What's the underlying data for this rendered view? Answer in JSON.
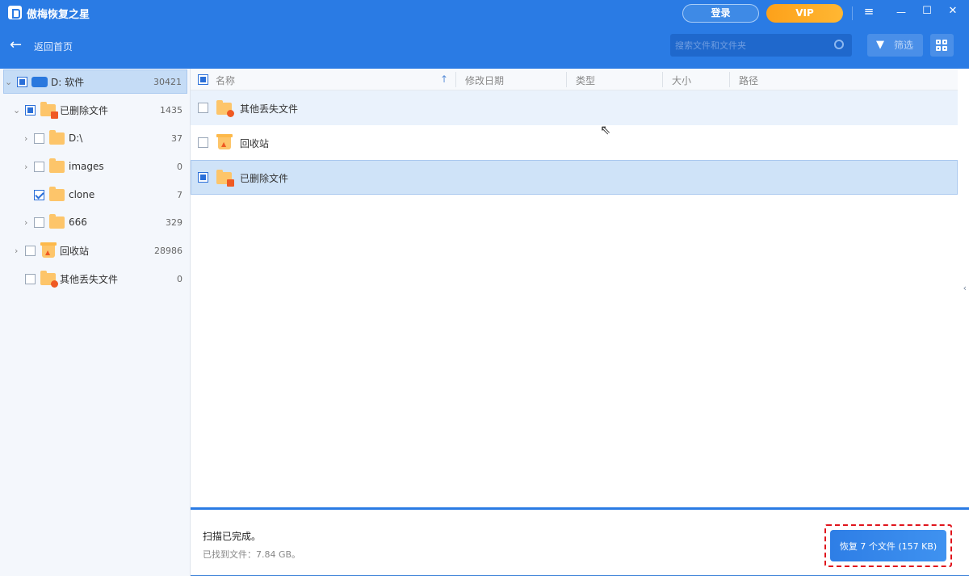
{
  "app": {
    "title": "傲梅恢复之星",
    "login": "登录",
    "vip": "VIP"
  },
  "window": {
    "menu": "≡",
    "minimize": "—",
    "maximize": "☐",
    "close": "✕"
  },
  "toolbar": {
    "back": "返回首页",
    "search_placeholder": "搜索文件和文件夹",
    "filter": "筛选"
  },
  "tree": [
    {
      "label": "D: 软件",
      "count": "30421"
    },
    {
      "label": "已删除文件",
      "count": "1435"
    },
    {
      "label": "D:\\",
      "count": "37"
    },
    {
      "label": "images",
      "count": "0"
    },
    {
      "label": "clone",
      "count": "7"
    },
    {
      "label": "666",
      "count": "329"
    },
    {
      "label": "回收站",
      "count": "28986"
    },
    {
      "label": "其他丢失文件",
      "count": "0"
    }
  ],
  "table": {
    "columns": [
      "名称",
      "修改日期",
      "类型",
      "大小",
      "路径"
    ],
    "rows": [
      {
        "name": "其他丢失文件"
      },
      {
        "name": "回收站"
      },
      {
        "name": "已删除文件"
      }
    ]
  },
  "footer": {
    "status": "扫描已完成。",
    "found": "已找到文件：7.84 GB。",
    "recover": "恢复 7 个文件 (157 KB)"
  }
}
